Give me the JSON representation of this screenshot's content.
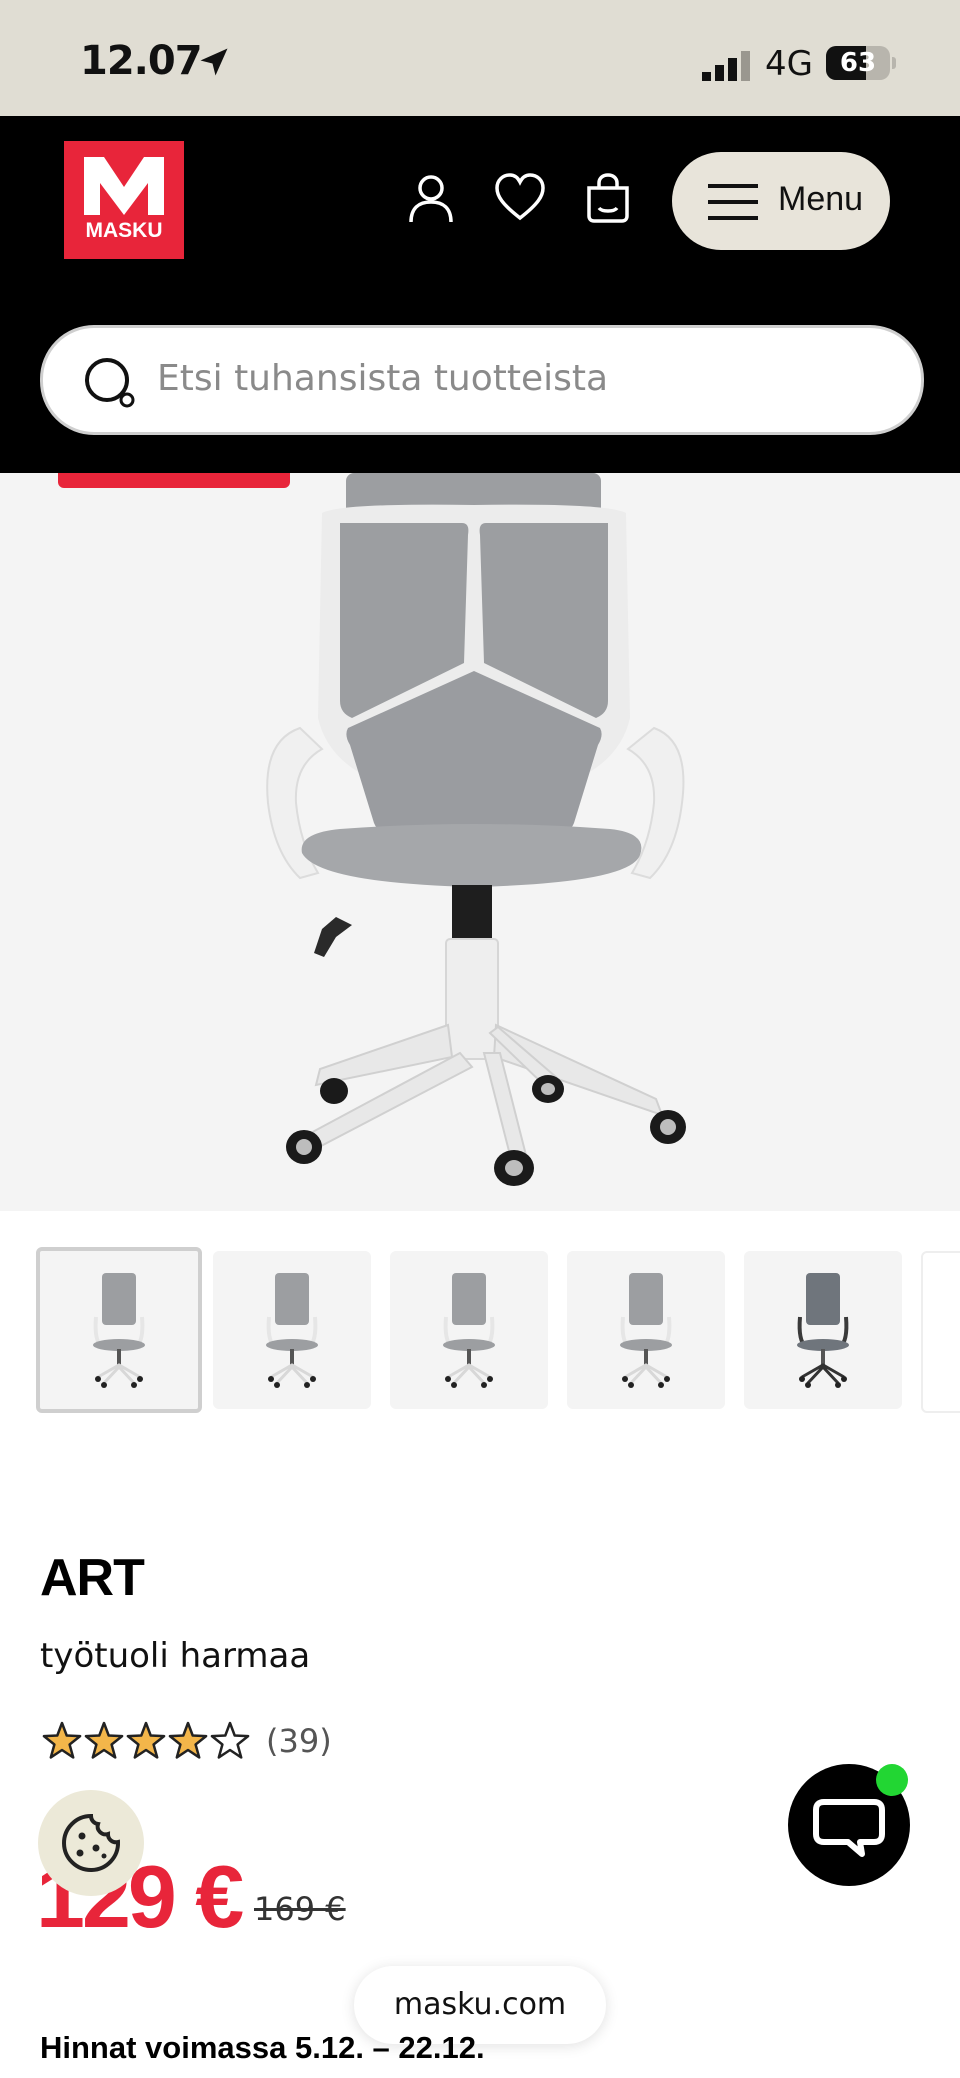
{
  "status_bar": {
    "time": "12.07",
    "network": "4G",
    "battery": "63",
    "battery_level": 0.63
  },
  "header": {
    "logo_letter": "M",
    "logo_text": "MASKU",
    "menu_label": "Menu",
    "icons": [
      "account-icon",
      "wishlist-heart-icon",
      "cart-bag-icon",
      "hamburger-icon"
    ]
  },
  "search": {
    "placeholder": "Etsi tuhansista tuotteista"
  },
  "gallery": {
    "thumbnail_count": 6,
    "active_index": 0
  },
  "product": {
    "name": "ART",
    "description": "työtuoli harmaa",
    "rating": 4,
    "rating_max": 5,
    "review_count": "(39)",
    "price": "129 €",
    "old_price": "169 €",
    "price_validity": "Hinnat voimassa 5.12. – 22.12."
  },
  "browser": {
    "url": "masku.com"
  },
  "colors": {
    "brand_red": "#e8253a",
    "header_bg": "#000000",
    "star": "#f3b64a",
    "online_dot": "#22d633"
  }
}
